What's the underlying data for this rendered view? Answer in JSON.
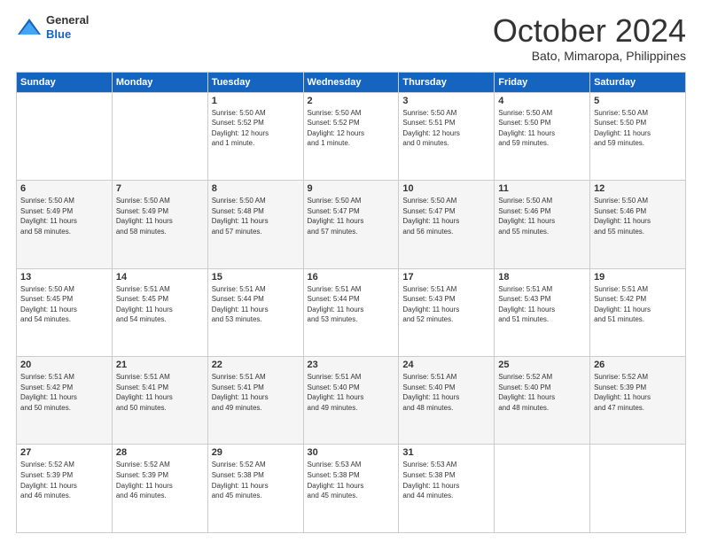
{
  "logo": {
    "line1": "General",
    "line2": "Blue"
  },
  "title": "October 2024",
  "location": "Bato, Mimaropa, Philippines",
  "days_header": [
    "Sunday",
    "Monday",
    "Tuesday",
    "Wednesday",
    "Thursday",
    "Friday",
    "Saturday"
  ],
  "weeks": [
    [
      {
        "day": "",
        "info": ""
      },
      {
        "day": "",
        "info": ""
      },
      {
        "day": "1",
        "info": "Sunrise: 5:50 AM\nSunset: 5:52 PM\nDaylight: 12 hours\nand 1 minute."
      },
      {
        "day": "2",
        "info": "Sunrise: 5:50 AM\nSunset: 5:52 PM\nDaylight: 12 hours\nand 1 minute."
      },
      {
        "day": "3",
        "info": "Sunrise: 5:50 AM\nSunset: 5:51 PM\nDaylight: 12 hours\nand 0 minutes."
      },
      {
        "day": "4",
        "info": "Sunrise: 5:50 AM\nSunset: 5:50 PM\nDaylight: 11 hours\nand 59 minutes."
      },
      {
        "day": "5",
        "info": "Sunrise: 5:50 AM\nSunset: 5:50 PM\nDaylight: 11 hours\nand 59 minutes."
      }
    ],
    [
      {
        "day": "6",
        "info": "Sunrise: 5:50 AM\nSunset: 5:49 PM\nDaylight: 11 hours\nand 58 minutes."
      },
      {
        "day": "7",
        "info": "Sunrise: 5:50 AM\nSunset: 5:49 PM\nDaylight: 11 hours\nand 58 minutes."
      },
      {
        "day": "8",
        "info": "Sunrise: 5:50 AM\nSunset: 5:48 PM\nDaylight: 11 hours\nand 57 minutes."
      },
      {
        "day": "9",
        "info": "Sunrise: 5:50 AM\nSunset: 5:47 PM\nDaylight: 11 hours\nand 57 minutes."
      },
      {
        "day": "10",
        "info": "Sunrise: 5:50 AM\nSunset: 5:47 PM\nDaylight: 11 hours\nand 56 minutes."
      },
      {
        "day": "11",
        "info": "Sunrise: 5:50 AM\nSunset: 5:46 PM\nDaylight: 11 hours\nand 55 minutes."
      },
      {
        "day": "12",
        "info": "Sunrise: 5:50 AM\nSunset: 5:46 PM\nDaylight: 11 hours\nand 55 minutes."
      }
    ],
    [
      {
        "day": "13",
        "info": "Sunrise: 5:50 AM\nSunset: 5:45 PM\nDaylight: 11 hours\nand 54 minutes."
      },
      {
        "day": "14",
        "info": "Sunrise: 5:51 AM\nSunset: 5:45 PM\nDaylight: 11 hours\nand 54 minutes."
      },
      {
        "day": "15",
        "info": "Sunrise: 5:51 AM\nSunset: 5:44 PM\nDaylight: 11 hours\nand 53 minutes."
      },
      {
        "day": "16",
        "info": "Sunrise: 5:51 AM\nSunset: 5:44 PM\nDaylight: 11 hours\nand 53 minutes."
      },
      {
        "day": "17",
        "info": "Sunrise: 5:51 AM\nSunset: 5:43 PM\nDaylight: 11 hours\nand 52 minutes."
      },
      {
        "day": "18",
        "info": "Sunrise: 5:51 AM\nSunset: 5:43 PM\nDaylight: 11 hours\nand 51 minutes."
      },
      {
        "day": "19",
        "info": "Sunrise: 5:51 AM\nSunset: 5:42 PM\nDaylight: 11 hours\nand 51 minutes."
      }
    ],
    [
      {
        "day": "20",
        "info": "Sunrise: 5:51 AM\nSunset: 5:42 PM\nDaylight: 11 hours\nand 50 minutes."
      },
      {
        "day": "21",
        "info": "Sunrise: 5:51 AM\nSunset: 5:41 PM\nDaylight: 11 hours\nand 50 minutes."
      },
      {
        "day": "22",
        "info": "Sunrise: 5:51 AM\nSunset: 5:41 PM\nDaylight: 11 hours\nand 49 minutes."
      },
      {
        "day": "23",
        "info": "Sunrise: 5:51 AM\nSunset: 5:40 PM\nDaylight: 11 hours\nand 49 minutes."
      },
      {
        "day": "24",
        "info": "Sunrise: 5:51 AM\nSunset: 5:40 PM\nDaylight: 11 hours\nand 48 minutes."
      },
      {
        "day": "25",
        "info": "Sunrise: 5:52 AM\nSunset: 5:40 PM\nDaylight: 11 hours\nand 48 minutes."
      },
      {
        "day": "26",
        "info": "Sunrise: 5:52 AM\nSunset: 5:39 PM\nDaylight: 11 hours\nand 47 minutes."
      }
    ],
    [
      {
        "day": "27",
        "info": "Sunrise: 5:52 AM\nSunset: 5:39 PM\nDaylight: 11 hours\nand 46 minutes."
      },
      {
        "day": "28",
        "info": "Sunrise: 5:52 AM\nSunset: 5:39 PM\nDaylight: 11 hours\nand 46 minutes."
      },
      {
        "day": "29",
        "info": "Sunrise: 5:52 AM\nSunset: 5:38 PM\nDaylight: 11 hours\nand 45 minutes."
      },
      {
        "day": "30",
        "info": "Sunrise: 5:53 AM\nSunset: 5:38 PM\nDaylight: 11 hours\nand 45 minutes."
      },
      {
        "day": "31",
        "info": "Sunrise: 5:53 AM\nSunset: 5:38 PM\nDaylight: 11 hours\nand 44 minutes."
      },
      {
        "day": "",
        "info": ""
      },
      {
        "day": "",
        "info": ""
      }
    ]
  ]
}
